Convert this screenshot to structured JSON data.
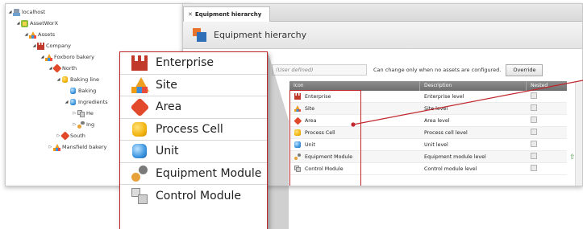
{
  "tree": {
    "items": [
      {
        "label": "localhost",
        "icon": "server-icon",
        "twisty": "◢"
      },
      {
        "label": "AssetWorX",
        "icon": "assetworx-icon",
        "twisty": "◢"
      },
      {
        "label": "Assets",
        "icon": "site-icon",
        "twisty": "◢"
      },
      {
        "label": "Company",
        "icon": "enterprise-icon",
        "twisty": "◢"
      },
      {
        "label": "Foxboro bakery",
        "icon": "site-icon",
        "twisty": "◢"
      },
      {
        "label": "North",
        "icon": "area-icon",
        "twisty": "◢"
      },
      {
        "label": "Baking line",
        "icon": "process-cell-icon",
        "twisty": "◢"
      },
      {
        "label": "Baking",
        "icon": "unit-icon",
        "twisty": ""
      },
      {
        "label": "Ingredients",
        "icon": "unit-icon",
        "twisty": "◢"
      },
      {
        "label": "He",
        "icon": "control-module-icon",
        "twisty": "▷"
      },
      {
        "label": "Ing",
        "icon": "equipment-module-icon",
        "twisty": "▷"
      },
      {
        "label": "South",
        "icon": "area-icon",
        "twisty": "▷"
      },
      {
        "label": "Mansfield bakery",
        "icon": "site-icon",
        "twisty": "▷"
      }
    ]
  },
  "main": {
    "tab_label": "Equipment hierarchy",
    "title": "Equipment hierarchy",
    "user_defined_placeholder": "(User defined)",
    "note": "Can change only when no assets are configured.",
    "override_label": "Override",
    "columns": [
      "Icon",
      "Description",
      "Nested"
    ],
    "rows": [
      {
        "name": "Enterprise",
        "description": "Enterprise level",
        "icon": "enterprise-icon"
      },
      {
        "name": "Site",
        "description": "Site level",
        "icon": "site-icon"
      },
      {
        "name": "Area",
        "description": "Area level",
        "icon": "area-icon"
      },
      {
        "name": "Process Cell",
        "description": "Process cell level",
        "icon": "process-cell-icon"
      },
      {
        "name": "Unit",
        "description": "Unit level",
        "icon": "unit-icon"
      },
      {
        "name": "Equipment Module",
        "description": "Equipment module level",
        "icon": "equipment-module-icon"
      },
      {
        "name": "Control Module",
        "description": "Control module level",
        "icon": "control-module-icon"
      }
    ]
  },
  "zoom": {
    "items": [
      {
        "label": "Enterprise",
        "icon": "enterprise-icon"
      },
      {
        "label": "Site",
        "icon": "site-icon"
      },
      {
        "label": "Area",
        "icon": "area-icon"
      },
      {
        "label": "Process Cell",
        "icon": "process-cell-icon"
      },
      {
        "label": "Unit",
        "icon": "unit-icon"
      },
      {
        "label": "Equipment Module",
        "icon": "equipment-module-icon"
      },
      {
        "label": "Control Module",
        "icon": "control-module-icon"
      }
    ]
  },
  "colors": {
    "highlight": "#c0262c",
    "header": "#7a7a7a"
  }
}
